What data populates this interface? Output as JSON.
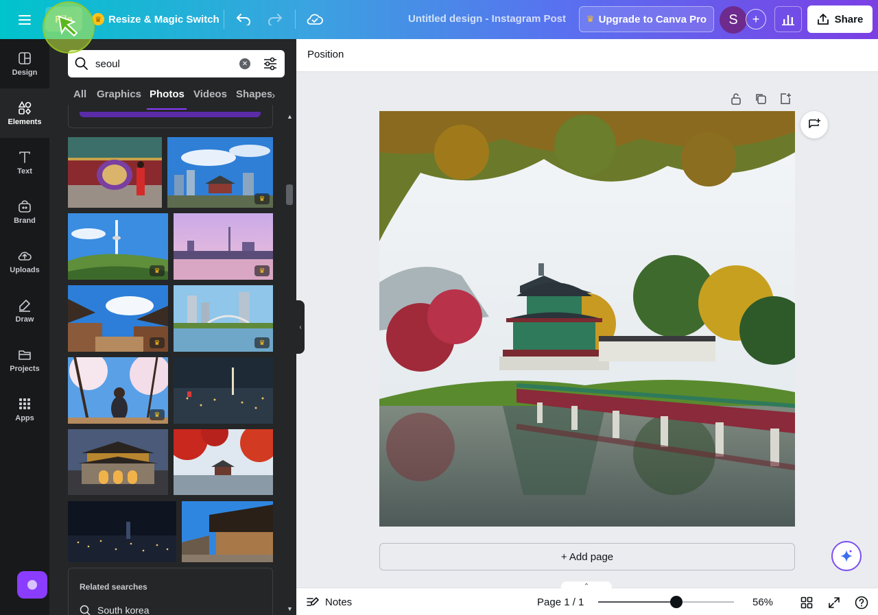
{
  "topbar": {
    "file_label": "File",
    "resize_label": "Resize & Magic Switch",
    "doc_title": "Untitled design - Instagram Post",
    "upgrade_label": "Upgrade to Canva Pro",
    "avatar_initial": "S",
    "share_label": "Share"
  },
  "rail": {
    "items": [
      {
        "label": "Design",
        "icon": "design-icon"
      },
      {
        "label": "Elements",
        "icon": "elements-icon",
        "active": true
      },
      {
        "label": "Text",
        "icon": "text-icon"
      },
      {
        "label": "Brand",
        "icon": "brand-icon"
      },
      {
        "label": "Uploads",
        "icon": "uploads-icon"
      },
      {
        "label": "Draw",
        "icon": "draw-icon"
      },
      {
        "label": "Projects",
        "icon": "projects-icon"
      },
      {
        "label": "Apps",
        "icon": "apps-icon"
      }
    ]
  },
  "panel": {
    "search": {
      "value": "seoul",
      "placeholder": "Search elements"
    },
    "tabs": [
      "All",
      "Graphics",
      "Photos",
      "Videos",
      "Shapes"
    ],
    "active_tab": "Photos",
    "photos": [
      {
        "subject": "royal drum ceremony",
        "pro": false
      },
      {
        "subject": "palace and city skyline",
        "pro": true
      },
      {
        "subject": "namsan tower hill",
        "pro": true
      },
      {
        "subject": "city at dusk",
        "pro": true
      },
      {
        "subject": "hanok rooftops",
        "pro": true
      },
      {
        "subject": "river bridge skyline",
        "pro": true
      },
      {
        "subject": "woman under cherry blossoms",
        "pro": true
      },
      {
        "subject": "night city from above",
        "pro": false
      },
      {
        "subject": "gwanghwamun gate at night",
        "pro": false
      },
      {
        "subject": "autumn pavilion",
        "pro": false
      },
      {
        "subject": "city lights at night",
        "pro": false
      },
      {
        "subject": "hanok village street",
        "pro": false
      }
    ],
    "related": {
      "title": "Related searches",
      "items": [
        "South korea"
      ]
    }
  },
  "editor": {
    "position_label": "Position",
    "add_page_label": "+ Add page"
  },
  "footer": {
    "notes_label": "Notes",
    "page_indicator": "Page 1 / 1",
    "zoom": 56,
    "zoom_label": "56%"
  },
  "colors": {
    "accent": "#8b3dff",
    "crown": "#ffc21a",
    "rail_bg": "#18191b",
    "panel_bg": "#252627"
  }
}
